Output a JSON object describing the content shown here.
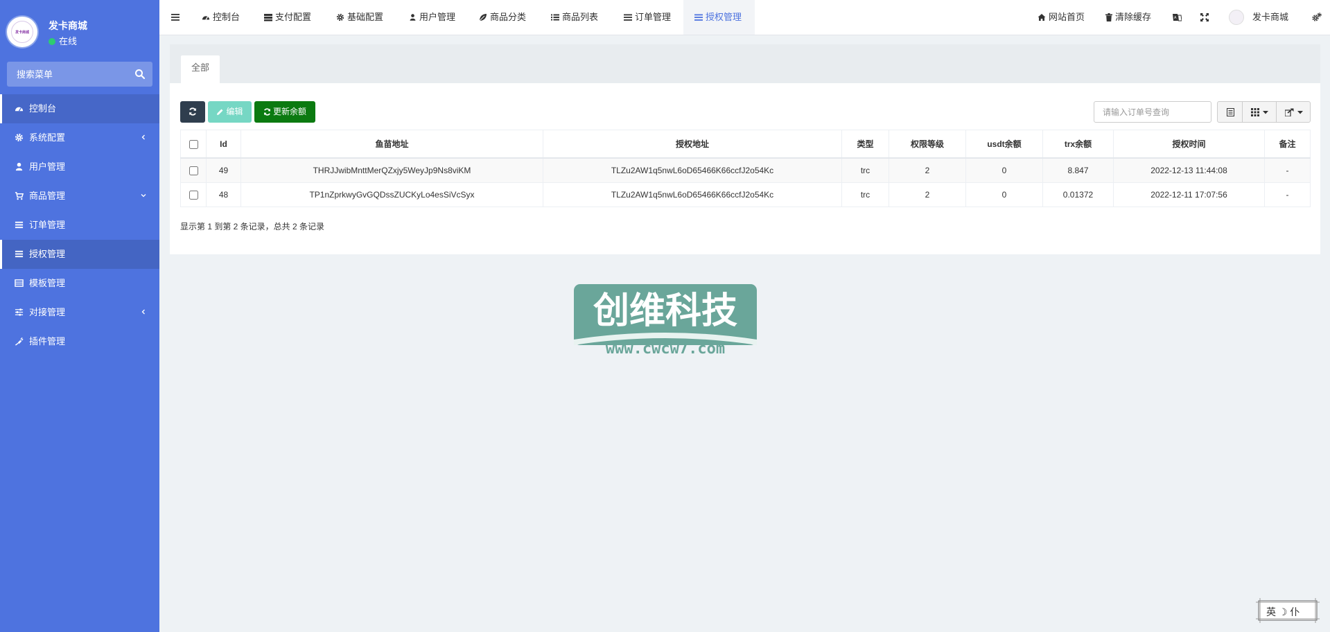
{
  "sidebar": {
    "shop_name": "发卡商城",
    "status": "在线",
    "avatar_text": "发卡商城",
    "search_placeholder": "搜索菜单",
    "items": [
      {
        "label": "控制台",
        "icon": "dashboard-icon",
        "active": false
      },
      {
        "label": "系统配置",
        "icon": "gear-icon",
        "chevron": "left"
      },
      {
        "label": "用户管理",
        "icon": "user-icon"
      },
      {
        "label": "商品管理",
        "icon": "cart-icon",
        "chevron": "down"
      },
      {
        "label": "订单管理",
        "icon": "list-icon"
      },
      {
        "label": "授权管理",
        "icon": "list-icon",
        "active": true
      },
      {
        "label": "模板管理",
        "icon": "template-icon"
      },
      {
        "label": "对接管理",
        "icon": "sliders-icon",
        "chevron": "left"
      },
      {
        "label": "插件管理",
        "icon": "plug-icon"
      }
    ]
  },
  "topnav": {
    "tabs": [
      "控制台",
      "支付配置",
      "基础配置",
      "用户管理",
      "商品分类",
      "商品列表",
      "订单管理",
      "授权管理"
    ],
    "active_tab": "授权管理",
    "right": {
      "home": "网站首页",
      "clear_cache": "清除缓存",
      "user": "发卡商城"
    }
  },
  "content": {
    "tab_all": "全部",
    "buttons": {
      "edit": "编辑",
      "update_balance": "更新余额"
    },
    "search_placeholder": "请输入订单号查询",
    "table": {
      "headers": [
        "Id",
        "鱼苗地址",
        "授权地址",
        "类型",
        "权限等级",
        "usdt余额",
        "trx余额",
        "授权时间",
        "备注"
      ],
      "rows": [
        [
          "49",
          "THRJJwibMnttMerQZxjy5WeyJp9Ns8viKM",
          "TLZu2AW1q5nwL6oD65466K66ccfJ2o54Kc",
          "trc",
          "2",
          "0",
          "8.847",
          "2022-12-13 11:44:08",
          "-"
        ],
        [
          "48",
          "TP1nZprkwyGvGQDssZUCKyLo4esSiVcSyx",
          "TLZu2AW1q5nwL6oD65466K66ccfJ2o54Kc",
          "trc",
          "2",
          "0",
          "0.01372",
          "2022-12-11 17:07:56",
          "-"
        ]
      ]
    },
    "pager_text": "显示第 1 到第 2 条记录，总共 2 条记录"
  },
  "watermark": {
    "title": "创维科技",
    "url": "www.cwcw7.com"
  },
  "ime": {
    "text": "英 ☽ 仆"
  },
  "colors": {
    "sidebar": "#4e73df",
    "active_tab": "#4e73df",
    "btn_dark": "#2f3e4e",
    "btn_edit": "#76d7c4",
    "btn_green": "#0b7a10",
    "watermark_bg": "#6aa69a"
  }
}
